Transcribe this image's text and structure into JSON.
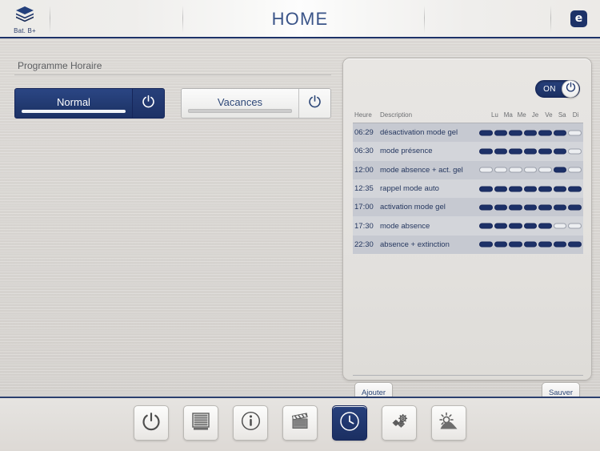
{
  "header": {
    "logo_icon": "layers-stack-icon",
    "logo_label": "Bat. B+",
    "title": "HOME",
    "brand_badge": "e",
    "brand_badge_icon": "e-brand-icon",
    "accent_color": "#1d3268"
  },
  "left_panel": {
    "section_title": "Programme Horaire",
    "programs": [
      {
        "label": "Normal",
        "state": "active",
        "power_icon": "power-icon"
      },
      {
        "label": "Vacances",
        "state": "inactive",
        "power_icon": "power-icon"
      }
    ]
  },
  "schedule_panel": {
    "toggle": {
      "label": "ON",
      "state": "on",
      "knob_icon": "power-icon"
    },
    "columns": {
      "time": "Heure",
      "description": "Description",
      "days": [
        "Lu",
        "Ma",
        "Me",
        "Je",
        "Ve",
        "Sa",
        "Di"
      ]
    },
    "rows": [
      {
        "time": "06:29",
        "description": "désactivation mode gel",
        "days": [
          1,
          1,
          1,
          1,
          1,
          1,
          0
        ]
      },
      {
        "time": "06:30",
        "description": "mode présence",
        "days": [
          1,
          1,
          1,
          1,
          1,
          1,
          0
        ]
      },
      {
        "time": "12:00",
        "description": "mode absence + act. gel",
        "days": [
          0,
          0,
          0,
          0,
          0,
          1,
          0
        ]
      },
      {
        "time": "12:35",
        "description": "rappel mode auto",
        "days": [
          1,
          1,
          1,
          1,
          1,
          1,
          1
        ]
      },
      {
        "time": "17:00",
        "description": "activation mode gel",
        "days": [
          1,
          1,
          1,
          1,
          1,
          1,
          1
        ]
      },
      {
        "time": "17:30",
        "description": "mode absence",
        "days": [
          1,
          1,
          1,
          1,
          1,
          0,
          0
        ]
      },
      {
        "time": "22:30",
        "description": "absence + extinction",
        "days": [
          1,
          1,
          1,
          1,
          1,
          1,
          1
        ]
      }
    ],
    "add_button": "Ajouter",
    "save_button": "Sauver"
  },
  "dock": {
    "items": [
      {
        "name": "power",
        "icon": "power-icon",
        "active": false
      },
      {
        "name": "blinds",
        "icon": "blinds-icon",
        "active": false
      },
      {
        "name": "info",
        "icon": "info-icon",
        "active": false
      },
      {
        "name": "scenes",
        "icon": "clapperboard-icon",
        "active": false
      },
      {
        "name": "schedule",
        "icon": "clock-icon",
        "active": true
      },
      {
        "name": "settings",
        "icon": "gears-icon",
        "active": false
      },
      {
        "name": "weather",
        "icon": "sun-hill-icon",
        "active": false
      }
    ]
  }
}
